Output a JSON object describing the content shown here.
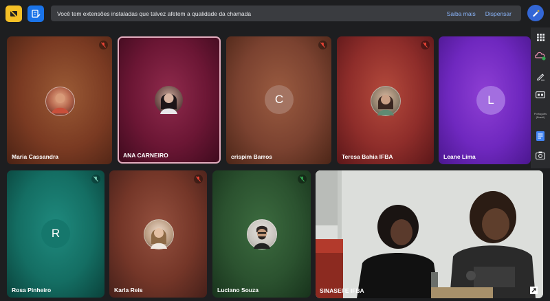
{
  "banner": {
    "message": "Você tem extensões instaladas que talvez afetem a qualidade da chamada",
    "learn_more": "Saiba mais",
    "dismiss": "Dispensar"
  },
  "sidebar": {
    "items": [
      {
        "icon": "apps-grid-icon"
      },
      {
        "icon": "cloud-extension-icon"
      },
      {
        "icon": "pen-icon"
      },
      {
        "icon": "captions-icon"
      },
      {
        "icon": "translation-text",
        "label": "Português (Brasil)"
      },
      {
        "icon": "notes-icon"
      },
      {
        "icon": "camera-icon"
      }
    ]
  },
  "participants": [
    {
      "name": "Maria Cassandra",
      "avatar": "photo",
      "muted": true
    },
    {
      "name": "ANA CARNEIRO",
      "avatar": "photo",
      "muted": false,
      "active": true
    },
    {
      "name": "crispim Barros",
      "initial": "C",
      "muted": true
    },
    {
      "name": "Teresa Bahia IFBA",
      "avatar": "photo",
      "muted": true
    },
    {
      "name": "Leane Lima",
      "initial": "L",
      "muted": false
    },
    {
      "name": "Rosa Pinheiro",
      "initial": "R",
      "muted": true
    },
    {
      "name": "Karla Reis",
      "avatar": "photo",
      "muted": true
    },
    {
      "name": "Luciano Souza",
      "avatar": "photo",
      "muted": false,
      "speaking": true
    },
    {
      "name": "SINASEFE IFBA",
      "video": true
    }
  ],
  "colors": {
    "background": "#1d1e20",
    "accent_blue": "#1a73e8",
    "link": "#8ab4f8",
    "mute_red": "#ea4335",
    "mute_green": "#34a853"
  }
}
